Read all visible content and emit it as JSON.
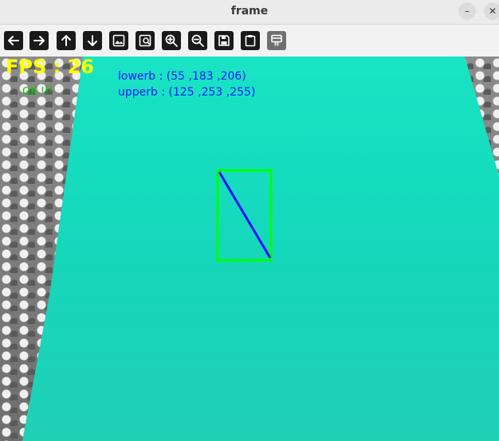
{
  "window": {
    "title": "frame",
    "minimize_glyph": "–",
    "close_glyph": "✕"
  },
  "toolbar": {
    "buttons": [
      {
        "name": "pan-left-icon",
        "enabled": true
      },
      {
        "name": "pan-right-icon",
        "enabled": true
      },
      {
        "name": "pan-up-icon",
        "enabled": true
      },
      {
        "name": "pan-down-icon",
        "enabled": true
      },
      {
        "name": "zoom-in-image-icon",
        "enabled": true
      },
      {
        "name": "zoom-image-fit-icon",
        "enabled": true
      },
      {
        "name": "zoom-in-icon",
        "enabled": true
      },
      {
        "name": "zoom-out-icon",
        "enabled": true
      },
      {
        "name": "save-icon",
        "enabled": true
      },
      {
        "name": "copy-clipboard-icon",
        "enabled": true
      },
      {
        "name": "properties-icon",
        "enabled": false
      }
    ]
  },
  "overlay": {
    "fps": "FPS : 26",
    "status": "OK !!!",
    "lowerb": "lowerb : (55 ,183 ,206)",
    "upperb": "upperb : (125 ,253 ,255)"
  },
  "colors": {
    "fps_text": "#ffff00",
    "status_text": "#00d000",
    "bound_text": "#1a1aff",
    "surface": "#16ddc0",
    "bounding_box": "#00ff00",
    "detected_line": "#1010ff"
  }
}
